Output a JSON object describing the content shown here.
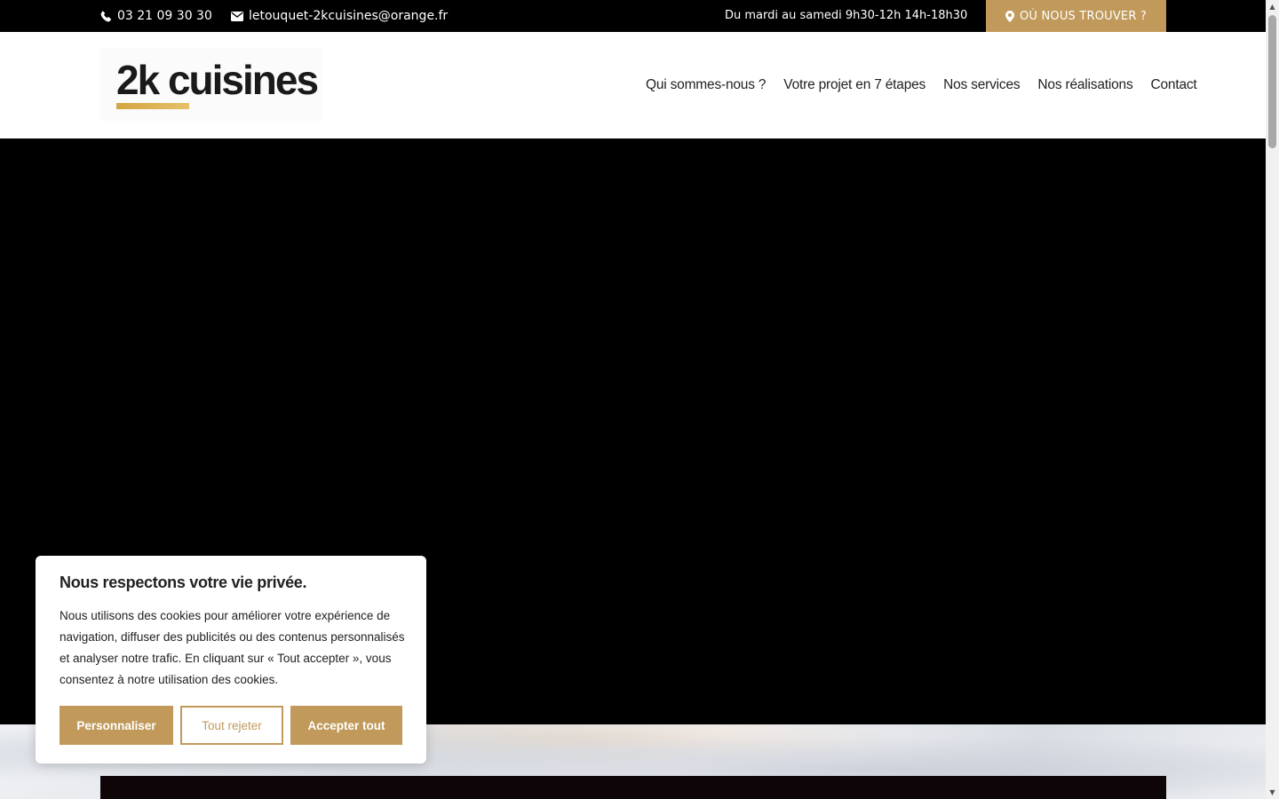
{
  "topbar": {
    "phone": "03 21 09 30 30",
    "email": "letouquet-2kcuisines@orange.fr",
    "hours": "Du mardi au samedi 9h30-12h 14h-18h30",
    "find_us": "OÙ NOUS TROUVER ?"
  },
  "header": {
    "logo_text": "2k cuisines",
    "nav": [
      {
        "label": "Qui sommes-nous ?"
      },
      {
        "label": "Votre projet en 7 étapes"
      },
      {
        "label": "Nos services"
      },
      {
        "label": "Nos réalisations"
      },
      {
        "label": "Contact"
      }
    ]
  },
  "cookie_banner": {
    "title": "Nous respectons votre vie privée.",
    "text": "Nous utilisons des cookies pour améliorer votre expérience de navigation, diffuser des publicités ou des contenus personnalisés et analyser notre trafic. En cliquant sur « Tout accepter », vous consentez à notre utilisation des cookies.",
    "buttons": {
      "customize": "Personnaliser",
      "reject": "Tout rejeter",
      "accept": "Accepter tout"
    }
  },
  "colors": {
    "accent": "#c19a5b",
    "topbar_bg": "#000000",
    "hero_bg": "#000000"
  },
  "icons": {
    "phone": "phone-icon",
    "email": "envelope-icon",
    "location": "map-marker-icon"
  }
}
